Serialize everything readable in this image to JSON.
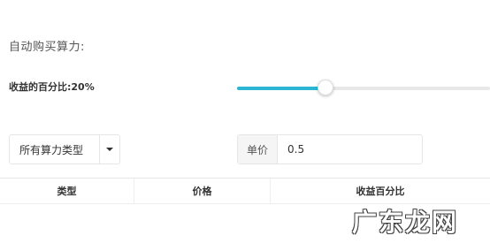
{
  "section": {
    "title": "自动购买算力:"
  },
  "profit_ratio": {
    "label": "收益的百分比:20%",
    "slider_fraction": 0.35
  },
  "filter": {
    "type_select_value": "所有算力类型",
    "price_addon_label": "单价",
    "price_value": "0.5"
  },
  "table": {
    "columns": [
      "类型",
      "价格",
      "收益百分比"
    ]
  },
  "watermark": {
    "text": "广东龙网"
  },
  "colors": {
    "accent": "#2bb7d4",
    "track": "#e8e8e8",
    "border": "#e6e6e6"
  }
}
